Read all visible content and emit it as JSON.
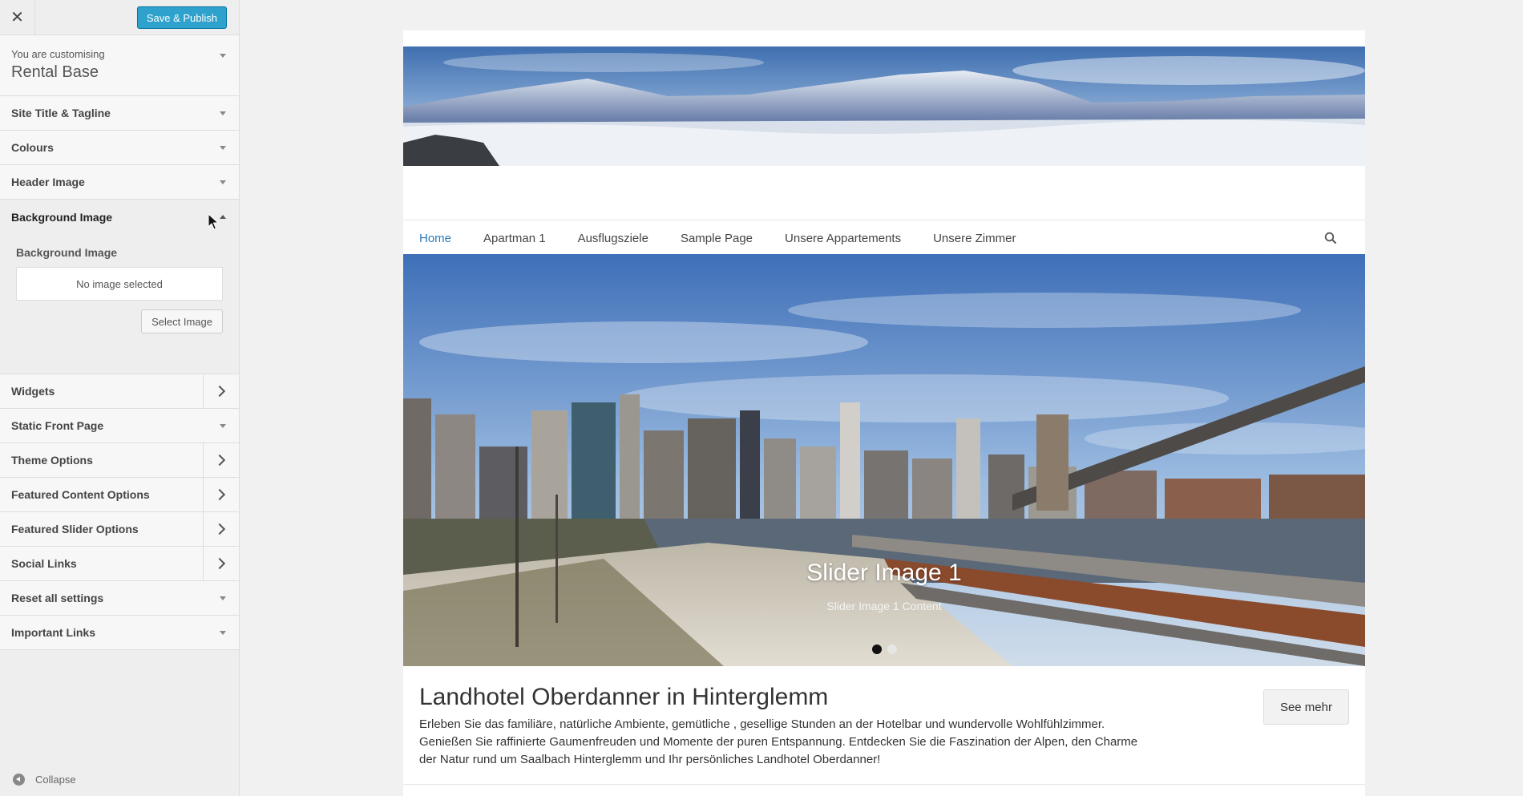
{
  "customizer": {
    "close_label": "✕",
    "save_publish": "Save & Publish",
    "customising_label": "You are customising",
    "theme_name": "Rental Base",
    "sections": {
      "site_title": "Site Title & Tagline",
      "colours": "Colours",
      "header_image": "Header Image",
      "background_image": "Background Image",
      "widgets": "Widgets",
      "static_front_page": "Static Front Page",
      "theme_options": "Theme Options",
      "featured_content": "Featured Content Options",
      "featured_slider": "Featured Slider Options",
      "social_links": "Social Links",
      "reset": "Reset all settings",
      "important_links": "Important Links"
    },
    "background_panel": {
      "control_title": "Background Image",
      "no_image": "No image selected",
      "select_button": "Select Image"
    },
    "collapse_label": "Collapse"
  },
  "site": {
    "nav": [
      "Home",
      "Apartman 1",
      "Ausflugsziele",
      "Sample Page",
      "Unsere Appartements",
      "Unsere Zimmer"
    ],
    "active_nav": "Home",
    "slider": {
      "title": "Slider Image 1",
      "content": "Slider Image 1 Content",
      "dot_count": 2,
      "active_dot": 1
    },
    "intro": {
      "title": "Landhotel Oberdanner in Hinterglemm",
      "text": "Erleben Sie das familiäre, natürliche Ambiente, gemütliche , gesellige Stunden an der Hotelbar und wundervolle Wohlfühlzimmer. Genießen Sie raffinierte Gaumenfreuden und Momente der puren Entspannung. Entdecken Sie die Faszination der Alpen, den Charme der Natur rund um Saalbach Hinterglemm und Ihr persönliches Landhotel Oberdanner!",
      "button": "See mehr"
    }
  },
  "colors": {
    "primary_button": "#2ea2cc",
    "active_nav_link": "#2b7ab8"
  },
  "icons": [
    "close-icon",
    "chevron-right-icon",
    "arrow-down-icon",
    "arrow-up-icon",
    "search-icon",
    "collapse-icon",
    "mouse-cursor-icon"
  ]
}
